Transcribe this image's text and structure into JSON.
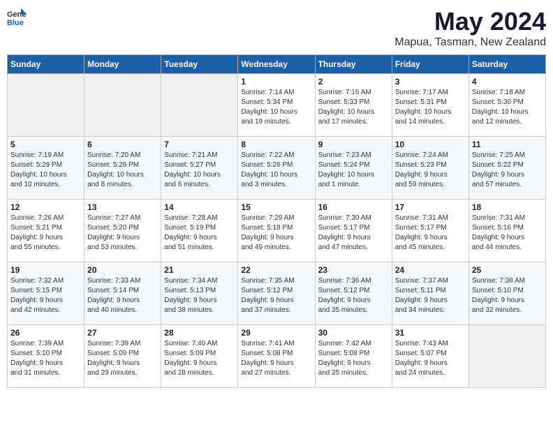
{
  "header": {
    "logo_general": "General",
    "logo_blue": "Blue",
    "month_title": "May 2024",
    "location": "Mapua, Tasman, New Zealand"
  },
  "weekdays": [
    "Sunday",
    "Monday",
    "Tuesday",
    "Wednesday",
    "Thursday",
    "Friday",
    "Saturday"
  ],
  "weeks": [
    [
      {
        "day": "",
        "info": ""
      },
      {
        "day": "",
        "info": ""
      },
      {
        "day": "",
        "info": ""
      },
      {
        "day": "1",
        "info": "Sunrise: 7:14 AM\nSunset: 5:34 PM\nDaylight: 10 hours\nand 19 minutes."
      },
      {
        "day": "2",
        "info": "Sunrise: 7:16 AM\nSunset: 5:33 PM\nDaylight: 10 hours\nand 17 minutes."
      },
      {
        "day": "3",
        "info": "Sunrise: 7:17 AM\nSunset: 5:31 PM\nDaylight: 10 hours\nand 14 minutes."
      },
      {
        "day": "4",
        "info": "Sunrise: 7:18 AM\nSunset: 5:30 PM\nDaylight: 10 hours\nand 12 minutes."
      }
    ],
    [
      {
        "day": "5",
        "info": "Sunrise: 7:19 AM\nSunset: 5:29 PM\nDaylight: 10 hours\nand 10 minutes."
      },
      {
        "day": "6",
        "info": "Sunrise: 7:20 AM\nSunset: 5:28 PM\nDaylight: 10 hours\nand 8 minutes."
      },
      {
        "day": "7",
        "info": "Sunrise: 7:21 AM\nSunset: 5:27 PM\nDaylight: 10 hours\nand 6 minutes."
      },
      {
        "day": "8",
        "info": "Sunrise: 7:22 AM\nSunset: 5:26 PM\nDaylight: 10 hours\nand 3 minutes."
      },
      {
        "day": "9",
        "info": "Sunrise: 7:23 AM\nSunset: 5:24 PM\nDaylight: 10 hours\nand 1 minute."
      },
      {
        "day": "10",
        "info": "Sunrise: 7:24 AM\nSunset: 5:23 PM\nDaylight: 9 hours\nand 59 minutes."
      },
      {
        "day": "11",
        "info": "Sunrise: 7:25 AM\nSunset: 5:22 PM\nDaylight: 9 hours\nand 57 minutes."
      }
    ],
    [
      {
        "day": "12",
        "info": "Sunrise: 7:26 AM\nSunset: 5:21 PM\nDaylight: 9 hours\nand 55 minutes."
      },
      {
        "day": "13",
        "info": "Sunrise: 7:27 AM\nSunset: 5:20 PM\nDaylight: 9 hours\nand 53 minutes."
      },
      {
        "day": "14",
        "info": "Sunrise: 7:28 AM\nSunset: 5:19 PM\nDaylight: 9 hours\nand 51 minutes."
      },
      {
        "day": "15",
        "info": "Sunrise: 7:29 AM\nSunset: 5:18 PM\nDaylight: 9 hours\nand 49 minutes."
      },
      {
        "day": "16",
        "info": "Sunrise: 7:30 AM\nSunset: 5:17 PM\nDaylight: 9 hours\nand 47 minutes."
      },
      {
        "day": "17",
        "info": "Sunrise: 7:31 AM\nSunset: 5:17 PM\nDaylight: 9 hours\nand 45 minutes."
      },
      {
        "day": "18",
        "info": "Sunrise: 7:31 AM\nSunset: 5:16 PM\nDaylight: 9 hours\nand 44 minutes."
      }
    ],
    [
      {
        "day": "19",
        "info": "Sunrise: 7:32 AM\nSunset: 5:15 PM\nDaylight: 9 hours\nand 42 minutes."
      },
      {
        "day": "20",
        "info": "Sunrise: 7:33 AM\nSunset: 5:14 PM\nDaylight: 9 hours\nand 40 minutes."
      },
      {
        "day": "21",
        "info": "Sunrise: 7:34 AM\nSunset: 5:13 PM\nDaylight: 9 hours\nand 38 minutes."
      },
      {
        "day": "22",
        "info": "Sunrise: 7:35 AM\nSunset: 5:12 PM\nDaylight: 9 hours\nand 37 minutes."
      },
      {
        "day": "23",
        "info": "Sunrise: 7:36 AM\nSunset: 5:12 PM\nDaylight: 9 hours\nand 35 minutes."
      },
      {
        "day": "24",
        "info": "Sunrise: 7:37 AM\nSunset: 5:11 PM\nDaylight: 9 hours\nand 34 minutes."
      },
      {
        "day": "25",
        "info": "Sunrise: 7:38 AM\nSunset: 5:10 PM\nDaylight: 9 hours\nand 32 minutes."
      }
    ],
    [
      {
        "day": "26",
        "info": "Sunrise: 7:39 AM\nSunset: 5:10 PM\nDaylight: 9 hours\nand 31 minutes."
      },
      {
        "day": "27",
        "info": "Sunrise: 7:39 AM\nSunset: 5:09 PM\nDaylight: 9 hours\nand 29 minutes."
      },
      {
        "day": "28",
        "info": "Sunrise: 7:40 AM\nSunset: 5:09 PM\nDaylight: 9 hours\nand 28 minutes."
      },
      {
        "day": "29",
        "info": "Sunrise: 7:41 AM\nSunset: 5:08 PM\nDaylight: 9 hours\nand 27 minutes."
      },
      {
        "day": "30",
        "info": "Sunrise: 7:42 AM\nSunset: 5:08 PM\nDaylight: 9 hours\nand 25 minutes."
      },
      {
        "day": "31",
        "info": "Sunrise: 7:43 AM\nSunset: 5:07 PM\nDaylight: 9 hours\nand 24 minutes."
      },
      {
        "day": "",
        "info": ""
      }
    ]
  ]
}
